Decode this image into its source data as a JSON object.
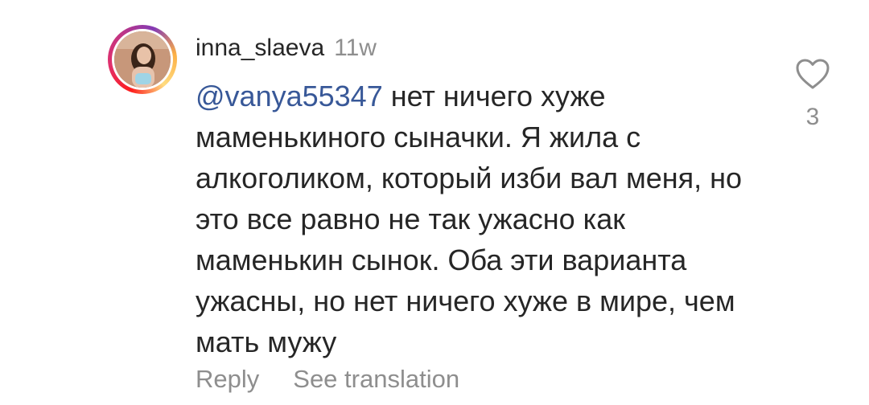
{
  "comment": {
    "username": "inna_slaeva",
    "time": "11w",
    "mention": "@vanya55347",
    "text": " нет ничего хуже маменькиного сыначки. Я жила с алкоголиком, который изби вал меня, но это все равно не так ужасно как маменькин сынок. Оба эти варианта ужасны, но нет ничего хуже в мире, чем мать мужу",
    "like_count": "3"
  },
  "actions": {
    "reply_label": "Reply",
    "translate_label": "See translation"
  },
  "icons": {
    "like": "heart-outline-icon",
    "avatar": "user-avatar"
  },
  "colors": {
    "mention": "#385898",
    "secondary_text": "#8e8e8e",
    "primary_text": "#262626"
  }
}
